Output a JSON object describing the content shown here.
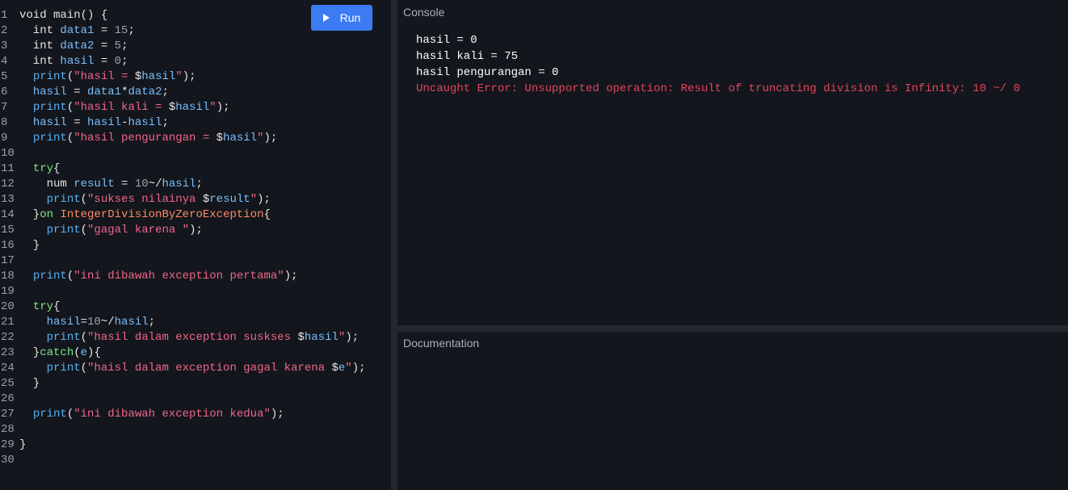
{
  "editor": {
    "lines": [
      {
        "n": "1",
        "tokens": [
          {
            "t": "void main() {",
            "c": "plain"
          }
        ]
      },
      {
        "n": "2",
        "tokens": [
          {
            "t": "  int ",
            "c": "plain"
          },
          {
            "t": "data1",
            "c": "ident"
          },
          {
            "t": " = ",
            "c": "plain"
          },
          {
            "t": "15",
            "c": "number"
          },
          {
            "t": ";",
            "c": "plain"
          }
        ]
      },
      {
        "n": "3",
        "tokens": [
          {
            "t": "  int ",
            "c": "plain"
          },
          {
            "t": "data2",
            "c": "ident"
          },
          {
            "t": " = ",
            "c": "plain"
          },
          {
            "t": "5",
            "c": "number"
          },
          {
            "t": ";",
            "c": "plain"
          }
        ]
      },
      {
        "n": "4",
        "tokens": [
          {
            "t": "  int ",
            "c": "plain"
          },
          {
            "t": "hasil",
            "c": "ident"
          },
          {
            "t": " = ",
            "c": "plain"
          },
          {
            "t": "0",
            "c": "number"
          },
          {
            "t": ";",
            "c": "plain"
          }
        ]
      },
      {
        "n": "5",
        "tokens": [
          {
            "t": "  ",
            "c": "plain"
          },
          {
            "t": "print",
            "c": "func"
          },
          {
            "t": "(",
            "c": "plain"
          },
          {
            "t": "\"hasil = ",
            "c": "string"
          },
          {
            "t": "$",
            "c": "plain"
          },
          {
            "t": "hasil",
            "c": "ident"
          },
          {
            "t": "\"",
            "c": "string"
          },
          {
            "t": ");",
            "c": "plain"
          }
        ]
      },
      {
        "n": "6",
        "tokens": [
          {
            "t": "  ",
            "c": "plain"
          },
          {
            "t": "hasil",
            "c": "ident"
          },
          {
            "t": " = ",
            "c": "plain"
          },
          {
            "t": "data1",
            "c": "ident"
          },
          {
            "t": "*",
            "c": "plain"
          },
          {
            "t": "data2",
            "c": "ident"
          },
          {
            "t": ";",
            "c": "plain"
          }
        ]
      },
      {
        "n": "7",
        "tokens": [
          {
            "t": "  ",
            "c": "plain"
          },
          {
            "t": "print",
            "c": "func"
          },
          {
            "t": "(",
            "c": "plain"
          },
          {
            "t": "\"hasil kali = ",
            "c": "string"
          },
          {
            "t": "$",
            "c": "plain"
          },
          {
            "t": "hasil",
            "c": "ident"
          },
          {
            "t": "\"",
            "c": "string"
          },
          {
            "t": ");",
            "c": "plain"
          }
        ]
      },
      {
        "n": "8",
        "tokens": [
          {
            "t": "  ",
            "c": "plain"
          },
          {
            "t": "hasil",
            "c": "ident"
          },
          {
            "t": " = ",
            "c": "plain"
          },
          {
            "t": "hasil",
            "c": "ident"
          },
          {
            "t": "-",
            "c": "plain"
          },
          {
            "t": "hasil",
            "c": "ident"
          },
          {
            "t": ";",
            "c": "plain"
          }
        ]
      },
      {
        "n": "9",
        "tokens": [
          {
            "t": "  ",
            "c": "plain"
          },
          {
            "t": "print",
            "c": "func"
          },
          {
            "t": "(",
            "c": "plain"
          },
          {
            "t": "\"hasil pengurangan = ",
            "c": "string"
          },
          {
            "t": "$",
            "c": "plain"
          },
          {
            "t": "hasil",
            "c": "ident"
          },
          {
            "t": "\"",
            "c": "string"
          },
          {
            "t": ");",
            "c": "plain"
          }
        ]
      },
      {
        "n": "10",
        "tokens": []
      },
      {
        "n": "11",
        "tokens": [
          {
            "t": "  ",
            "c": "plain"
          },
          {
            "t": "try",
            "c": "control"
          },
          {
            "t": "{",
            "c": "plain"
          }
        ]
      },
      {
        "n": "12",
        "tokens": [
          {
            "t": "    num ",
            "c": "plain"
          },
          {
            "t": "result",
            "c": "ident"
          },
          {
            "t": " = ",
            "c": "plain"
          },
          {
            "t": "10",
            "c": "number"
          },
          {
            "t": "~/",
            "c": "plain"
          },
          {
            "t": "hasil",
            "c": "ident"
          },
          {
            "t": ";",
            "c": "plain"
          }
        ]
      },
      {
        "n": "13",
        "tokens": [
          {
            "t": "    ",
            "c": "plain"
          },
          {
            "t": "print",
            "c": "func"
          },
          {
            "t": "(",
            "c": "plain"
          },
          {
            "t": "\"sukses nilainya ",
            "c": "string"
          },
          {
            "t": "$",
            "c": "plain"
          },
          {
            "t": "result",
            "c": "ident"
          },
          {
            "t": "\"",
            "c": "string"
          },
          {
            "t": ");",
            "c": "plain"
          }
        ]
      },
      {
        "n": "14",
        "tokens": [
          {
            "t": "  }",
            "c": "plain"
          },
          {
            "t": "on",
            "c": "control"
          },
          {
            "t": " ",
            "c": "plain"
          },
          {
            "t": "IntegerDivisionByZeroException",
            "c": "type"
          },
          {
            "t": "{",
            "c": "plain"
          }
        ]
      },
      {
        "n": "15",
        "tokens": [
          {
            "t": "    ",
            "c": "plain"
          },
          {
            "t": "print",
            "c": "func"
          },
          {
            "t": "(",
            "c": "plain"
          },
          {
            "t": "\"gagal karena \"",
            "c": "string"
          },
          {
            "t": ");",
            "c": "plain"
          }
        ]
      },
      {
        "n": "16",
        "tokens": [
          {
            "t": "  }",
            "c": "plain"
          }
        ]
      },
      {
        "n": "17",
        "tokens": []
      },
      {
        "n": "18",
        "tokens": [
          {
            "t": "  ",
            "c": "plain"
          },
          {
            "t": "print",
            "c": "func"
          },
          {
            "t": "(",
            "c": "plain"
          },
          {
            "t": "\"ini dibawah exception pertama\"",
            "c": "string"
          },
          {
            "t": ");",
            "c": "plain"
          }
        ]
      },
      {
        "n": "19",
        "tokens": []
      },
      {
        "n": "20",
        "tokens": [
          {
            "t": "  ",
            "c": "plain"
          },
          {
            "t": "try",
            "c": "control"
          },
          {
            "t": "{",
            "c": "plain"
          }
        ]
      },
      {
        "n": "21",
        "tokens": [
          {
            "t": "    ",
            "c": "plain"
          },
          {
            "t": "hasil",
            "c": "ident"
          },
          {
            "t": "=",
            "c": "plain"
          },
          {
            "t": "10",
            "c": "number"
          },
          {
            "t": "~/",
            "c": "plain"
          },
          {
            "t": "hasil",
            "c": "ident"
          },
          {
            "t": ";",
            "c": "plain"
          }
        ]
      },
      {
        "n": "22",
        "tokens": [
          {
            "t": "    ",
            "c": "plain"
          },
          {
            "t": "print",
            "c": "func"
          },
          {
            "t": "(",
            "c": "plain"
          },
          {
            "t": "\"hasil dalam exception suskses ",
            "c": "string"
          },
          {
            "t": "$",
            "c": "plain"
          },
          {
            "t": "hasil",
            "c": "ident"
          },
          {
            "t": "\"",
            "c": "string"
          },
          {
            "t": ");",
            "c": "plain"
          }
        ]
      },
      {
        "n": "23",
        "tokens": [
          {
            "t": "  }",
            "c": "plain"
          },
          {
            "t": "catch",
            "c": "control"
          },
          {
            "t": "(",
            "c": "plain"
          },
          {
            "t": "e",
            "c": "ident"
          },
          {
            "t": "){",
            "c": "plain"
          }
        ]
      },
      {
        "n": "24",
        "tokens": [
          {
            "t": "    ",
            "c": "plain"
          },
          {
            "t": "print",
            "c": "func"
          },
          {
            "t": "(",
            "c": "plain"
          },
          {
            "t": "\"haisl dalam exception gagal karena ",
            "c": "string"
          },
          {
            "t": "$",
            "c": "plain"
          },
          {
            "t": "e",
            "c": "ident"
          },
          {
            "t": "\"",
            "c": "string"
          },
          {
            "t": ");",
            "c": "plain"
          }
        ]
      },
      {
        "n": "25",
        "tokens": [
          {
            "t": "  }",
            "c": "plain"
          }
        ]
      },
      {
        "n": "26",
        "tokens": []
      },
      {
        "n": "27",
        "tokens": [
          {
            "t": "  ",
            "c": "plain"
          },
          {
            "t": "print",
            "c": "func"
          },
          {
            "t": "(",
            "c": "plain"
          },
          {
            "t": "\"ini dibawah exception kedua\"",
            "c": "string"
          },
          {
            "t": ");",
            "c": "plain"
          }
        ]
      },
      {
        "n": "28",
        "tokens": []
      },
      {
        "n": "29",
        "tokens": [
          {
            "t": "}",
            "c": "plain"
          }
        ]
      },
      {
        "n": "30",
        "tokens": []
      }
    ]
  },
  "toolbar": {
    "run_label": "Run",
    "run_icon": "play-icon",
    "run_color": "#3d7bf2"
  },
  "console": {
    "title": "Console",
    "output": [
      {
        "text": "hasil = 0",
        "kind": "stdout"
      },
      {
        "text": "hasil kali = 75",
        "kind": "stdout"
      },
      {
        "text": "hasil pengurangan = 0",
        "kind": "stdout"
      },
      {
        "text": "Uncaught Error: Unsupported operation: Result of truncating division is Infinity: 10 ~/ 0",
        "kind": "error"
      }
    ],
    "error_color": "#e2455e"
  },
  "documentation": {
    "title": "Documentation"
  }
}
